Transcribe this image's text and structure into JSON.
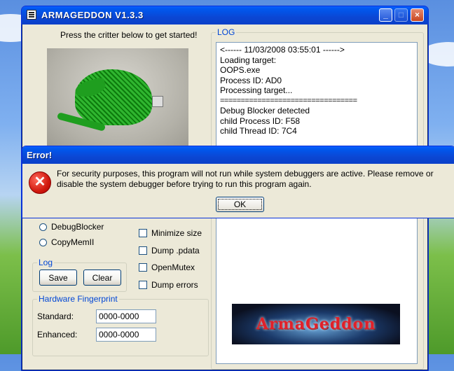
{
  "window": {
    "title": "ARMAGEDDON V1.3.3",
    "controls": {
      "minimize": "_",
      "maximize": "□",
      "close": "×"
    }
  },
  "critter": {
    "caption": "Press the critter below to get started!"
  },
  "log": {
    "group_title": "LOG",
    "lines": [
      "<------ 11/03/2008 03:55:01 ------>",
      "Loading target:",
      "OOPS.exe",
      "Process ID: AD0",
      "Processing target...",
      "=================================",
      "Debug Blocker detected",
      "child Process ID: F58",
      "child Thread ID: 7C4"
    ]
  },
  "options": {
    "radios": [
      "DebugBlocker",
      "CopyMemII"
    ],
    "checkboxes": [
      "Minimize size",
      "Dump .pdata",
      "OpenMutex",
      "Dump errors"
    ]
  },
  "log_controls": {
    "group_title": "Log",
    "save_label": "Save",
    "clear_label": "Clear"
  },
  "fingerprint": {
    "group_title": "Hardware Fingerprint",
    "standard_label": "Standard:",
    "standard_value": "0000-0000",
    "enhanced_label": "Enhanced:",
    "enhanced_value": "0000-0000"
  },
  "banner": {
    "text": "ArmaGeddon"
  },
  "dialog": {
    "title": "Error!",
    "message": "For security purposes, this program will not run while system debuggers are active. Please remove or disable the system debugger before trying to run this program again.",
    "ok_label": "OK",
    "icon_glyph": "✕"
  },
  "colors": {
    "titlebar": "#0b47d4",
    "window_bg": "#ece9d8",
    "group_title": "#0046d5",
    "error_red": "#d11a0f"
  }
}
